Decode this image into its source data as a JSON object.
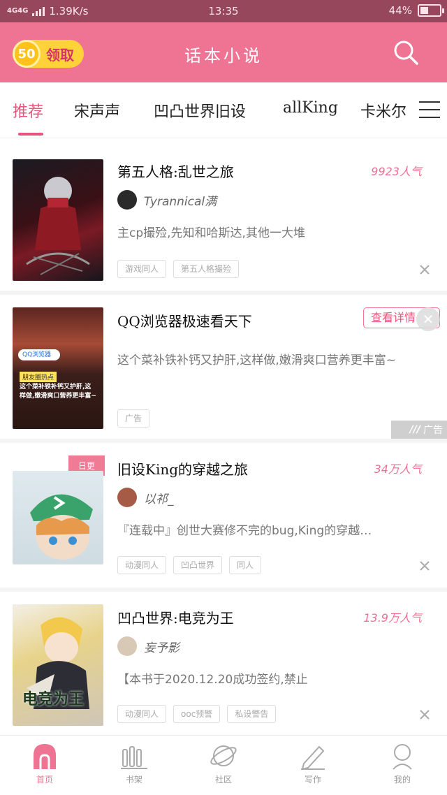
{
  "status_bar": {
    "network": "4G4G",
    "speed": "1.39K/s",
    "time": "13:35",
    "battery_percent": 44,
    "battery_label": "44%"
  },
  "header": {
    "coin_value": "50",
    "coin_button_label": "领取",
    "title": "话本小说"
  },
  "tabs": [
    {
      "label": "推荐",
      "active": true
    },
    {
      "label": "宋声声",
      "active": false
    },
    {
      "label": "凹凸世界旧设",
      "active": false
    },
    {
      "label": "allKing",
      "active": false
    },
    {
      "label": "卡米尔",
      "active": false
    }
  ],
  "feed": {
    "card1": {
      "title": "第五人格:乱世之旅",
      "popularity": "9923人气",
      "author": "Tyrannical满",
      "description": "主cp撮殓,先知和哈斯达,其他一大堆",
      "tags": [
        "游戏同人",
        "第五人格撮殓"
      ]
    },
    "ad": {
      "title": "QQ浏览器极速看天下",
      "button_label": "查看详情",
      "description": "这个菜补铁补钙又护肝,这样做,嫩滑爽口营养更丰富~",
      "tag": "广告",
      "ad_mark": "广告",
      "cover_brand": "QQ浏览器",
      "cover_badge": "朋友圈热点",
      "cover_caption": "这个菜补铁补钙又护肝,这样做,嫩滑爽口营养更丰富~"
    },
    "card2": {
      "badge": "日更",
      "title": "旧设King的穿越之旅",
      "popularity": "34万人气",
      "author": "以祁_",
      "description": "『连载中』创世大赛修不完的bug,King的穿越…",
      "tags": [
        "动漫同人",
        "凹凸世界",
        "同人"
      ]
    },
    "card3": {
      "title": "凹凸世界:电竞为王",
      "popularity": "13.9万人气",
      "author": "妄予影",
      "description": "【本书于2020.12.20成功签约,禁止",
      "tags": [
        "动漫同人",
        "ooc预警",
        "私设警告"
      ],
      "cover_text": "电竞为王"
    }
  },
  "bottom_nav": [
    {
      "label": "首页",
      "icon": "home-icon",
      "active": true
    },
    {
      "label": "书架",
      "icon": "bookshelf-icon",
      "active": false
    },
    {
      "label": "社区",
      "icon": "planet-icon",
      "active": false
    },
    {
      "label": "写作",
      "icon": "pen-icon",
      "active": false
    },
    {
      "label": "我的",
      "icon": "profile-icon",
      "active": false
    }
  ],
  "colors": {
    "accent": "#ef7392",
    "status_bar": "#96475c",
    "coin": "#ffd23a"
  }
}
